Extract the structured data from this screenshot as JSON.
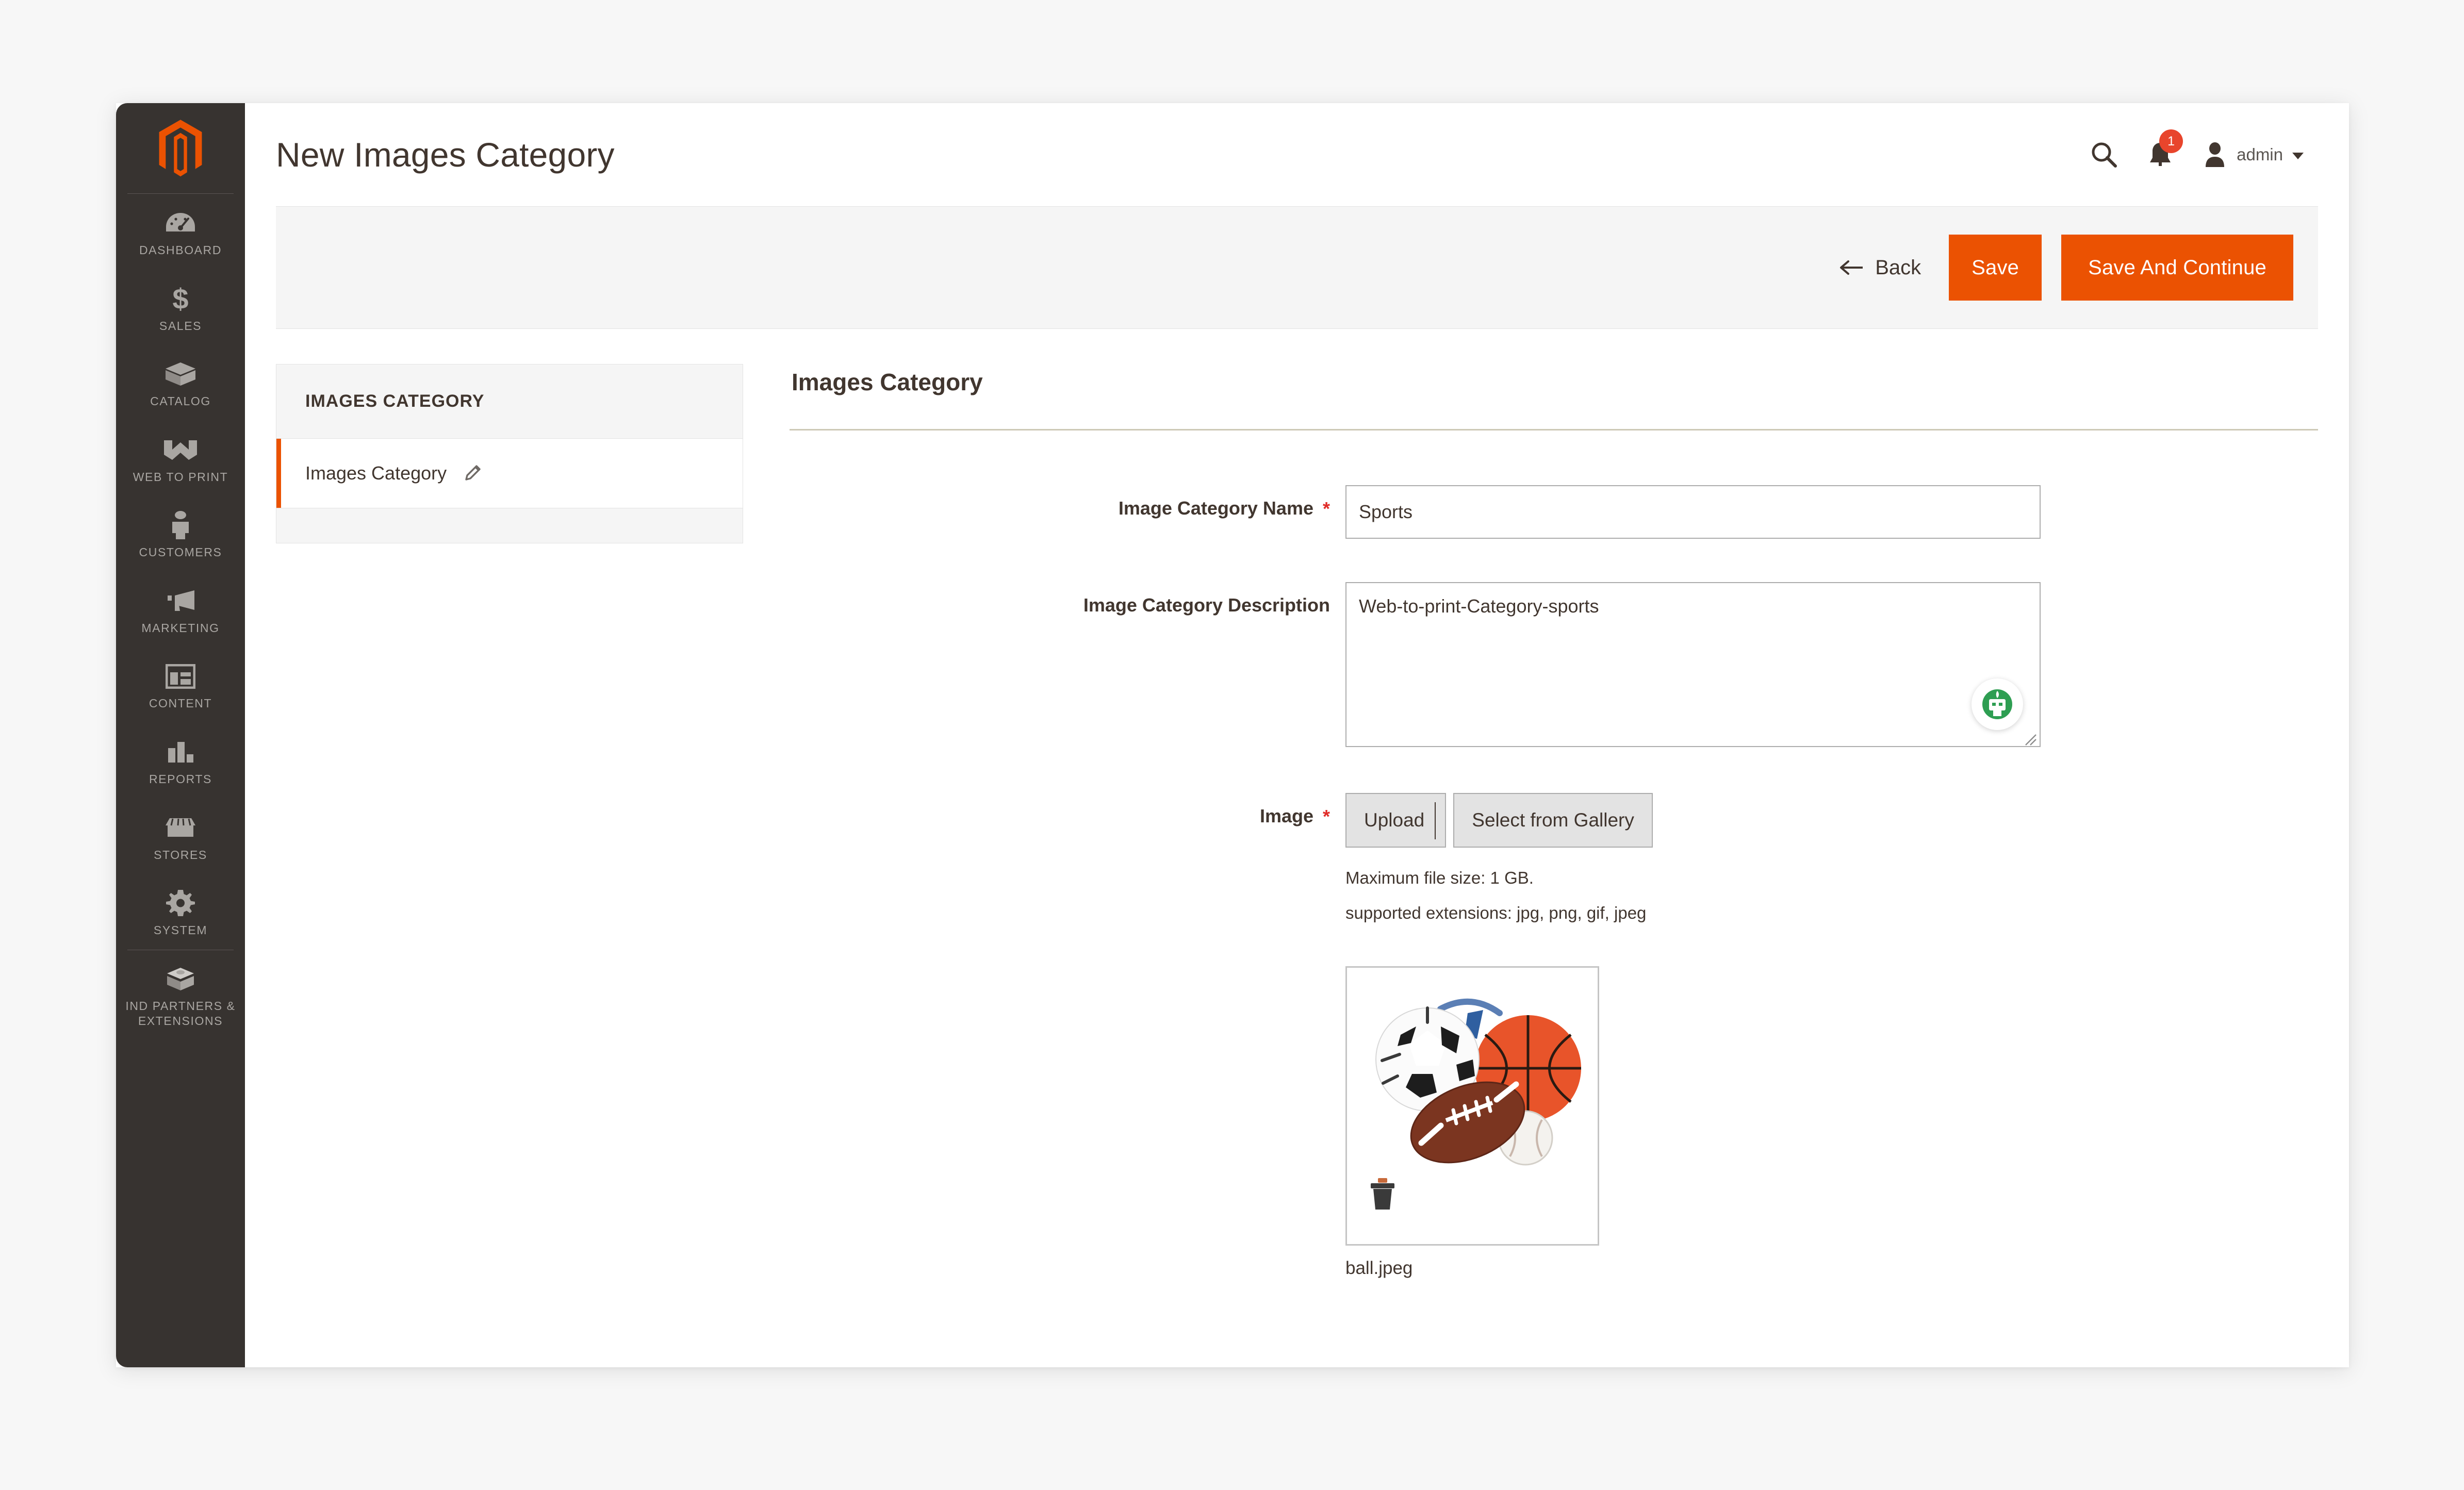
{
  "window": {
    "page_title": "New Images Category"
  },
  "header": {
    "search_icon": "search-icon",
    "notifications_icon": "bell-icon",
    "notifications_count": "1",
    "user_icon": "user-avatar-icon",
    "user_name": "admin",
    "caret_icon": "chevron-down-icon"
  },
  "sidebar": {
    "logo": "magento-logo",
    "items": [
      {
        "label": "DASHBOARD",
        "icon": "gauge-icon"
      },
      {
        "label": "SALES",
        "icon": "dollar-icon"
      },
      {
        "label": "CATALOG",
        "icon": "box-icon"
      },
      {
        "label": "WEB TO PRINT",
        "icon": "w-brand-icon"
      },
      {
        "label": "CUSTOMERS",
        "icon": "person-icon"
      },
      {
        "label": "MARKETING",
        "icon": "megaphone-icon"
      },
      {
        "label": "CONTENT",
        "icon": "layout-icon"
      },
      {
        "label": "REPORTS",
        "icon": "bar-chart-icon"
      },
      {
        "label": "STORES",
        "icon": "storefront-icon"
      },
      {
        "label": "SYSTEM",
        "icon": "gear-icon"
      },
      {
        "label": "IND PARTNERS & EXTENSIONS",
        "icon": "extension-box-icon"
      }
    ]
  },
  "toolbar": {
    "back_label": "Back",
    "back_icon": "arrow-left-icon",
    "save_label": "Save",
    "save_and_continue_label": "Save And Continue"
  },
  "tab_panel": {
    "heading": "IMAGES CATEGORY",
    "tabs": [
      {
        "label": "Images Category",
        "icon": "pencil-icon",
        "active": true
      }
    ]
  },
  "form": {
    "section_title": "Images Category",
    "fields": {
      "name": {
        "label": "Image Category Name",
        "required_marker": "*",
        "value": "Sports",
        "placeholder": ""
      },
      "description": {
        "label": "Image Category Description",
        "value": "Web-to-print-Category-sports",
        "placeholder": "",
        "assistant_icon": "grammar-robot-icon",
        "resize_icon": "resize-grip-icon"
      },
      "image": {
        "label": "Image",
        "required_marker": "*",
        "upload_label": "Upload",
        "gallery_label": "Select from Gallery",
        "max_size_hint": "Maximum file size: 1 GB.",
        "extensions_hint": "supported extensions: jpg, png, gif, jpeg",
        "preview_alt": "sports-balls-photo",
        "delete_icon": "trash-icon",
        "filename": "ball.jpeg"
      }
    }
  },
  "colors": {
    "brand_orange": "#eb5202",
    "badge_red": "#e8452c",
    "sidebar_dark": "#373330",
    "page_bg": "#f7f7f7",
    "divider_khaki": "#cdc9b6"
  }
}
